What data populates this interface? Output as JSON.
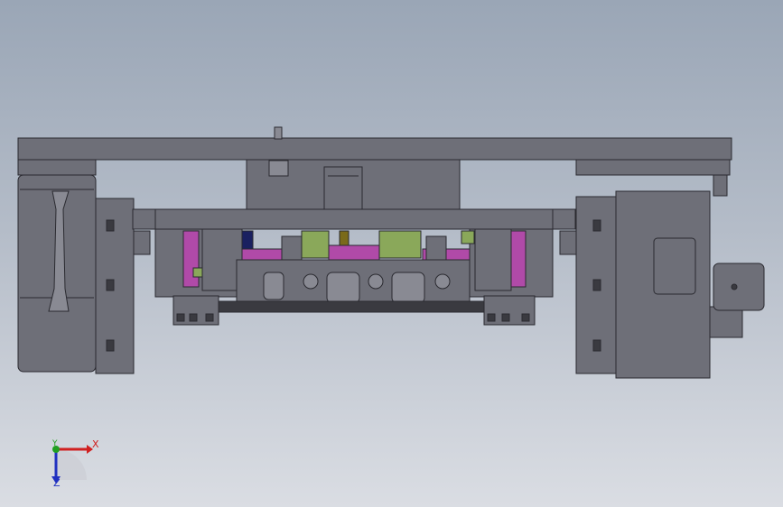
{
  "colors": {
    "frame": "#6e6f78",
    "frame_dark": "#3a3a40",
    "frame_light": "#898a93",
    "magenta": "#b04aa8",
    "green": "#8aa85a",
    "olive": "#7a6a1a",
    "navy": "#1a2060",
    "cyan": "#30a8b0",
    "axis_x": "#d02020",
    "axis_y": "#20a020",
    "axis_z": "#2030c0"
  },
  "triad": {
    "x": "X",
    "y": "Y",
    "z": "Z"
  }
}
